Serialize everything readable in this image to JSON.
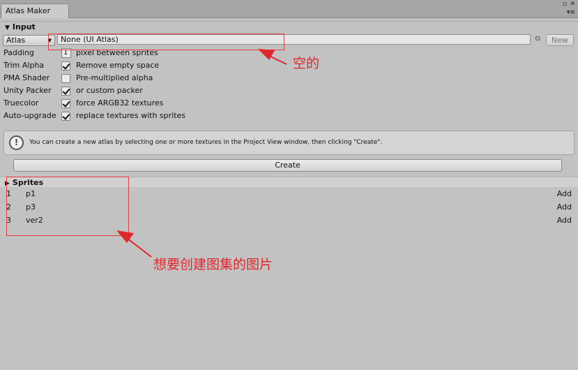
{
  "window": {
    "tab_title": "Atlas Maker"
  },
  "input": {
    "header": "Input",
    "atlas_popup_label": "Atlas",
    "atlas_field_value": "None (UI Atlas)",
    "new_button_label": "New",
    "settings": [
      {
        "label": "Padding",
        "type": "number",
        "value": "1",
        "description": "pixel between sprites"
      },
      {
        "label": "Trim Alpha",
        "type": "checkbox",
        "checked": true,
        "description": "Remove empty space"
      },
      {
        "label": "PMA Shader",
        "type": "checkbox",
        "checked": false,
        "description": "Pre-multiplied alpha"
      },
      {
        "label": "Unity Packer",
        "type": "checkbox",
        "checked": true,
        "description": "or custom packer"
      },
      {
        "label": "Truecolor",
        "type": "checkbox",
        "checked": true,
        "description": "force ARGB32 textures"
      },
      {
        "label": "Auto-upgrade",
        "type": "checkbox",
        "checked": true,
        "description": "replace textures with sprites"
      }
    ]
  },
  "help": {
    "text": "You can create a new atlas by selecting one or more textures in the Project View window, then clicking \"Create\"."
  },
  "create_button_label": "Create",
  "sprites": {
    "header": "Sprites",
    "items": [
      {
        "index": "1",
        "name": "p1",
        "action": "Add"
      },
      {
        "index": "2",
        "name": "p3",
        "action": "Add"
      },
      {
        "index": "3",
        "name": "ver2",
        "action": "Add"
      }
    ]
  },
  "annotations": {
    "empty_note": "空的",
    "sprites_note": "想要创建图集的图片",
    "color": "#e0262b"
  }
}
